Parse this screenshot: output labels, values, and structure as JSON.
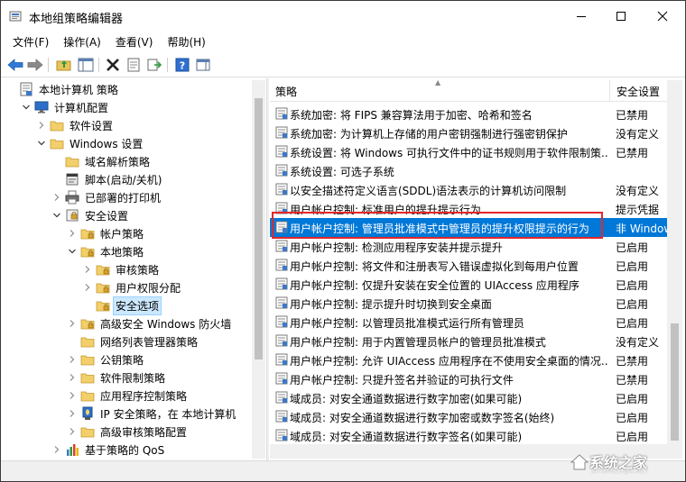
{
  "window": {
    "title": "本地组策略编辑器"
  },
  "menu": [
    "文件(F)",
    "操作(A)",
    "查看(V)",
    "帮助(H)"
  ],
  "tree": [
    {
      "label": "本地计算机 策略",
      "level": 0,
      "twisty": "",
      "icon": "computer-policy-icon"
    },
    {
      "label": "计算机配置",
      "level": 1,
      "twisty": "v",
      "icon": "computer-config-icon"
    },
    {
      "label": "软件设置",
      "level": 2,
      "twisty": ">",
      "icon": "folder-icon"
    },
    {
      "label": "Windows 设置",
      "level": 2,
      "twisty": "v",
      "icon": "folder-icon"
    },
    {
      "label": "域名解析策略",
      "level": 3,
      "twisty": "",
      "icon": "folder-icon"
    },
    {
      "label": "脚本(启动/关机)",
      "level": 3,
      "twisty": "",
      "icon": "script-icon"
    },
    {
      "label": "已部署的打印机",
      "level": 3,
      "twisty": ">",
      "icon": "printer-icon"
    },
    {
      "label": "安全设置",
      "level": 3,
      "twisty": "v",
      "icon": "security-icon"
    },
    {
      "label": "帐户策略",
      "level": 4,
      "twisty": ">",
      "icon": "folder-lock-icon"
    },
    {
      "label": "本地策略",
      "level": 4,
      "twisty": "v",
      "icon": "folder-lock-icon"
    },
    {
      "label": "审核策略",
      "level": 5,
      "twisty": ">",
      "icon": "folder-lock-icon"
    },
    {
      "label": "用户权限分配",
      "level": 5,
      "twisty": ">",
      "icon": "folder-lock-icon"
    },
    {
      "label": "安全选项",
      "level": 5,
      "twisty": "",
      "icon": "folder-lock-icon",
      "selected": true
    },
    {
      "label": "高级安全 Windows 防火墙",
      "level": 4,
      "twisty": ">",
      "icon": "folder-lock-icon"
    },
    {
      "label": "网络列表管理器策略",
      "level": 4,
      "twisty": "",
      "icon": "folder-icon"
    },
    {
      "label": "公钥策略",
      "level": 4,
      "twisty": ">",
      "icon": "folder-icon"
    },
    {
      "label": "软件限制策略",
      "level": 4,
      "twisty": ">",
      "icon": "folder-icon"
    },
    {
      "label": "应用程序控制策略",
      "level": 4,
      "twisty": ">",
      "icon": "folder-icon"
    },
    {
      "label": "IP 安全策略，在 本地计算机",
      "level": 4,
      "twisty": ">",
      "icon": "ip-security-icon"
    },
    {
      "label": "高级审核策略配置",
      "level": 4,
      "twisty": ">",
      "icon": "folder-icon"
    },
    {
      "label": "基于策略的 QoS",
      "level": 3,
      "twisty": ">",
      "icon": "qos-chart-icon"
    }
  ],
  "columns": {
    "policy": "策略",
    "setting": "安全设置"
  },
  "rows": [
    {
      "policy": "系统加密: 将 FIPS 兼容算法用于加密、哈希和签名",
      "setting": "已禁用"
    },
    {
      "policy": "系统加密: 为计算机上存储的用户密钥强制进行强密钥保护",
      "setting": "没有定义"
    },
    {
      "policy": "系统设置: 将 Windows 可执行文件中的证书规则用于软件限制策...",
      "setting": "已禁用"
    },
    {
      "policy": "系统设置: 可选子系统",
      "setting": ""
    },
    {
      "policy": "以安全描述符定义语言(SDDL)语法表示的计算机访问限制",
      "setting": "没有定义"
    },
    {
      "policy": "用户帐户控制: 标准用户的提升提示行为",
      "setting": "提示凭据"
    },
    {
      "policy": "用户帐户控制: 管理员批准模式中管理员的提升权限提示的行为",
      "setting": "非 Windows",
      "selected": true
    },
    {
      "policy": "用户帐户控制: 检测应用程序安装并提示提升",
      "setting": "已启用"
    },
    {
      "policy": "用户帐户控制: 将文件和注册表写入错误虚拟化到每用户位置",
      "setting": "已启用"
    },
    {
      "policy": "用户帐户控制: 仅提升安装在安全位置的 UIAccess 应用程序",
      "setting": "已启用"
    },
    {
      "policy": "用户帐户控制: 提示提升时切换到安全桌面",
      "setting": "已启用"
    },
    {
      "policy": "用户帐户控制: 以管理员批准模式运行所有管理员",
      "setting": "已启用"
    },
    {
      "policy": "用户帐户控制: 用于内置管理员帐户的管理员批准模式",
      "setting": "没有定义"
    },
    {
      "policy": "用户帐户控制: 允许 UIAccess 应用程序在不使用安全桌面的情况...",
      "setting": "已禁用"
    },
    {
      "policy": "用户帐户控制: 只提升签名并验证的可执行文件",
      "setting": "已禁用"
    },
    {
      "policy": "域成员: 对安全通道数据进行数字加密(如果可能)",
      "setting": "已启用"
    },
    {
      "policy": "域成员: 对安全通道数据进行数字加密或数字签名(始终)",
      "setting": "已启用"
    },
    {
      "policy": "域成员: 对安全通道数据进行数字签名(如果可能)",
      "setting": "已启用"
    }
  ],
  "watermark": {
    "text": "系统之家",
    "sub": "XITONGZHIJIA.NET"
  },
  "colors": {
    "selection": "#0078d7",
    "highlight_box": "#e3262b",
    "tree_selection": "#cce8ff"
  }
}
